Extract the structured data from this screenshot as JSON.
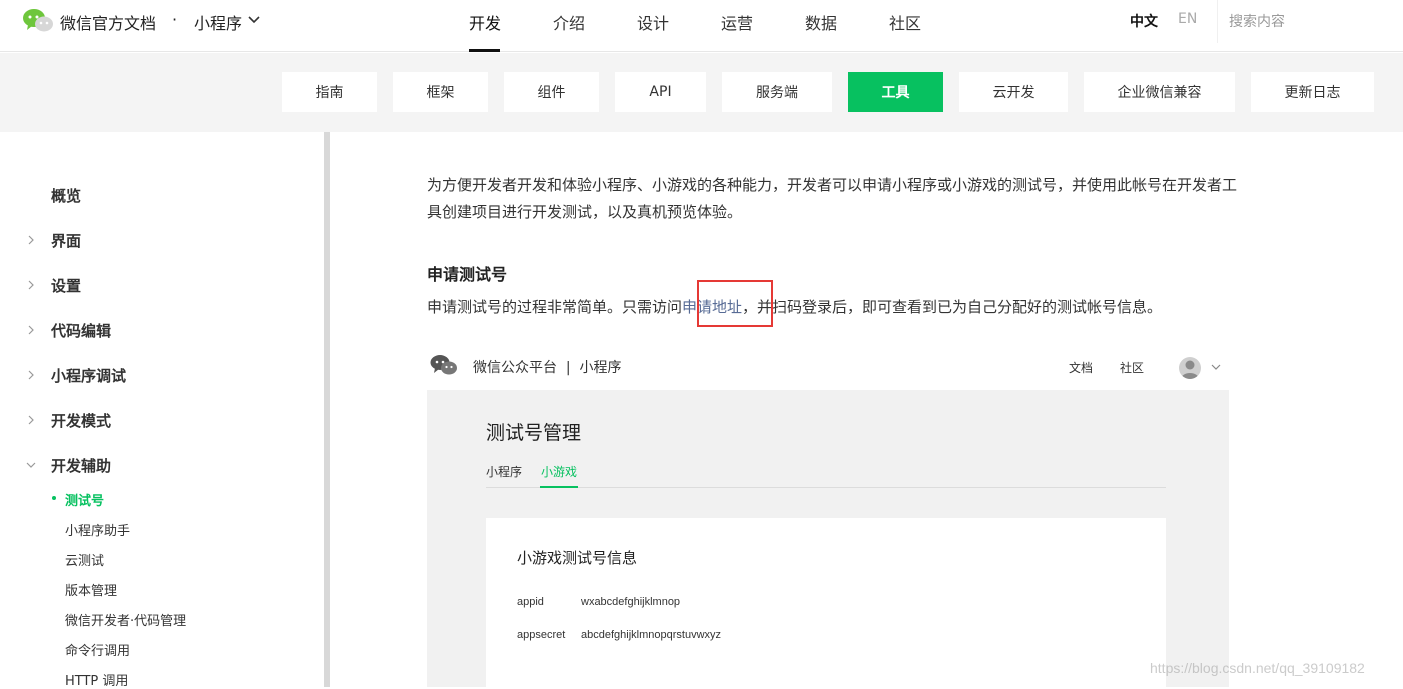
{
  "header": {
    "brand": "微信官方文档",
    "dot": "·",
    "product": "小程序",
    "nav": [
      "开发",
      "介绍",
      "设计",
      "运营",
      "数据",
      "社区"
    ],
    "active_nav": "开发",
    "lang_zh": "中文",
    "lang_en": "EN",
    "search_placeholder": "搜索内容"
  },
  "subnav": {
    "tabs": [
      "指南",
      "框架",
      "组件",
      "API",
      "服务端",
      "工具",
      "云开发",
      "企业微信兼容",
      "更新日志"
    ],
    "active": "工具"
  },
  "sidebar": {
    "items": [
      {
        "label": "概览",
        "arrow": "none"
      },
      {
        "label": "界面",
        "arrow": "right"
      },
      {
        "label": "设置",
        "arrow": "right"
      },
      {
        "label": "代码编辑",
        "arrow": "right"
      },
      {
        "label": "小程序调试",
        "arrow": "right"
      },
      {
        "label": "开发模式",
        "arrow": "right"
      },
      {
        "label": "开发辅助",
        "arrow": "down"
      }
    ],
    "sub_items": [
      "测试号",
      "小程序助手",
      "云测试",
      "版本管理",
      "微信开发者·代码管理",
      "命令行调用",
      "HTTP 调用"
    ],
    "active_sub": "测试号"
  },
  "content": {
    "intro": "为方便开发者开发和体验小程序、小游戏的各种能力，开发者可以申请小程序或小游戏的测试号，并使用此帐号在开发者工具创建项目进行开发测试，以及真机预览体验。",
    "section_title": "申请测试号",
    "section_text_before": "申请测试号的过程非常简单。只需访问",
    "section_link": "申请地址",
    "section_text_after": "，并扫码登录后，即可查看到已为自己分配好的测试帐号信息。"
  },
  "embed": {
    "brand": "微信公众平台  |  小程序",
    "doc": "文档",
    "community": "社区",
    "title": "测试号管理",
    "tabs": [
      "小程序",
      "小游戏"
    ],
    "active_tab": "小游戏",
    "card_title": "小游戏测试号信息",
    "fields": [
      {
        "label": "appid",
        "value": "wxabcdefghijklmnop"
      },
      {
        "label": "appsecret",
        "value": "abcdefghijklmnopqrstuvwxyz"
      }
    ]
  },
  "watermark": "https://blog.csdn.net/qq_39109182",
  "colors": {
    "accent": "#07c160",
    "link": "#576b95",
    "highlight": "#e53935"
  }
}
